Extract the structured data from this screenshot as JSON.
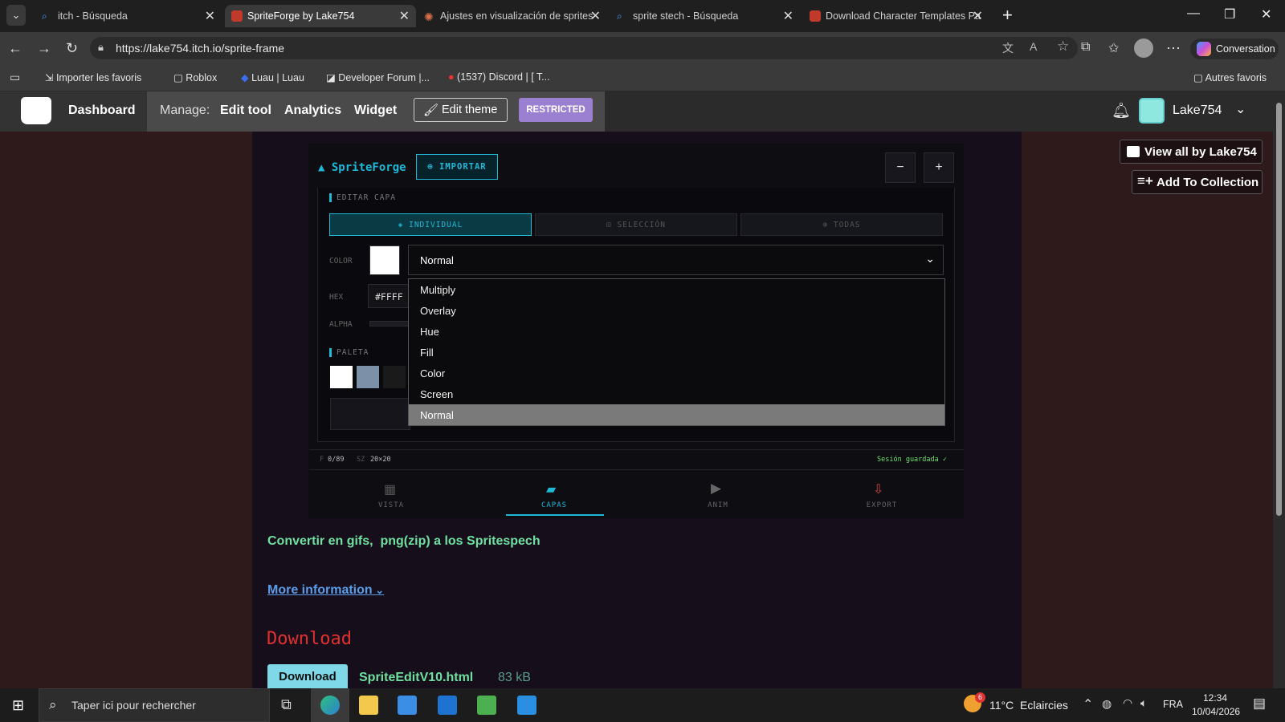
{
  "browser": {
    "tabs": [
      {
        "title": "itch - Búsqueda",
        "active": false
      },
      {
        "title": "SpriteForge by Lake754",
        "active": true
      },
      {
        "title": "Ajustes en visualización de sprites",
        "active": false
      },
      {
        "title": "sprite stech - Búsqueda",
        "active": false
      },
      {
        "title": "Download Character Templates Pa",
        "active": false
      }
    ],
    "url": "https://lake754.itch.io/sprite-frame",
    "conversation_label": "Conversation",
    "bookmarks": [
      "Importer les favoris",
      "Roblox",
      "Luau | Luau",
      "Developer Forum |...",
      "(1537) Discord | [ T...",
      "Autres favoris"
    ]
  },
  "itch": {
    "dashboard": "Dashboard",
    "manage": "Manage:",
    "edit_tool": "Edit tool",
    "analytics": "Analytics",
    "widget": "Widget",
    "edit_theme": "Edit theme",
    "restricted": "RESTRICTED",
    "username": "Lake754",
    "view_all": "View all by Lake754",
    "add_collection": "Add To Collection"
  },
  "app": {
    "title": "▲ SpriteForge",
    "import": "⊕ IMPORTAR",
    "zoom_out": "−",
    "zoom_in": "+",
    "section_edit": "EDITAR CAPA",
    "mode_individual": "◈ INDIVIDUAL",
    "mode_selection": "⊡ SELECCIÓN",
    "mode_all": "⊕ TODAS",
    "color_label": "COLOR",
    "hex_label": "HEX",
    "hex_value": "#FFFF",
    "alpha_label": "ALPHA",
    "palette_label": "PALETA",
    "blend_selected": "Normal",
    "blend_options": [
      "Multiply",
      "Overlay",
      "Hue",
      "Fill",
      "Color",
      "Screen",
      "Normal"
    ],
    "status_f_label": "F",
    "status_f": "0/89",
    "status_sz_label": "SZ",
    "status_sz": "20×20",
    "session": "Sesión guardada ✓",
    "bottom_tabs": [
      "VISTA",
      "CAPAS",
      "ANIM",
      "EXPORT"
    ]
  },
  "page": {
    "description": "Convertir en gifs,  png(zip) a los Spritespech",
    "more_info": "More information",
    "download_heading": "Download",
    "download_button": "Download",
    "file_name": "SpriteEditV10.html",
    "file_size": "83 kB"
  },
  "taskbar": {
    "search_placeholder": "Taper ici pour rechercher",
    "weather": "11°C  Eclaircies",
    "weather_badge": "6",
    "lang": "FRA",
    "time": "12:34",
    "date": "10/04/2026"
  },
  "colors": {
    "accent_cyan": "#1fb8d6",
    "accent_green": "#6fe0a0",
    "download_red": "#e03030",
    "restricted_purple": "#9b7fd0"
  }
}
